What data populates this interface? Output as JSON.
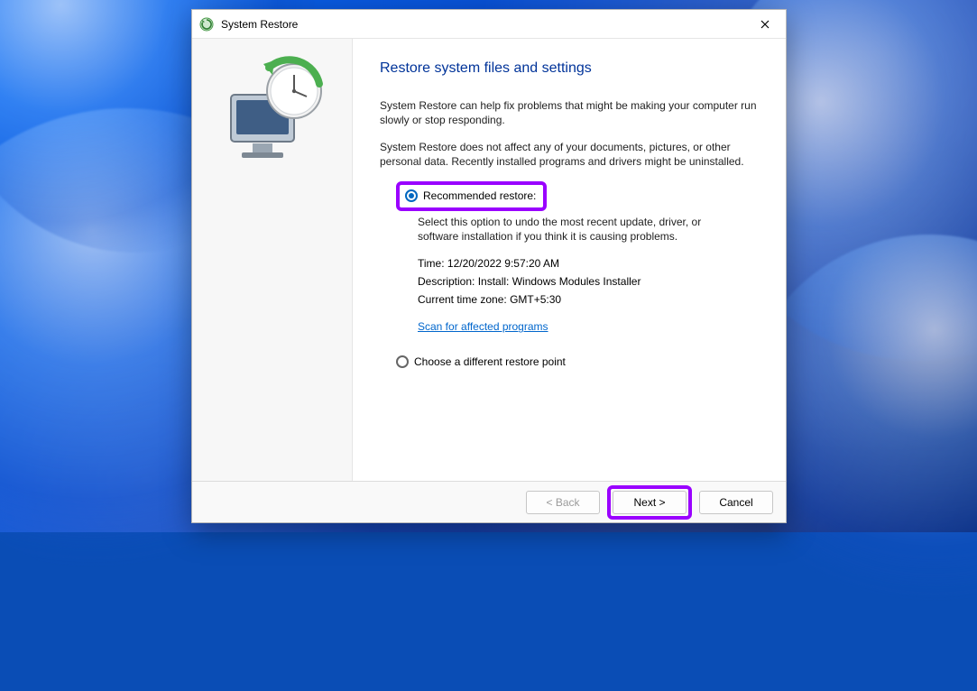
{
  "titlebar": {
    "title": "System Restore"
  },
  "heading": "Restore system files and settings",
  "intro1": "System Restore can help fix problems that might be making your computer run slowly or stop responding.",
  "intro2": "System Restore does not affect any of your documents, pictures, or other personal data. Recently installed programs and drivers might be uninstalled.",
  "options": {
    "recommended": {
      "label": "Recommended restore:",
      "description": "Select this option to undo the most recent update, driver, or software installation if you think it is causing problems.",
      "time_label": "Time:",
      "time_value": "12/20/2022 9:57:20 AM",
      "desc_label": "Description:",
      "desc_value": "Install: Windows Modules Installer",
      "tz_label": "Current time zone:",
      "tz_value": "GMT+5:30",
      "scan_link": "Scan for affected programs"
    },
    "choose_different": {
      "label": "Choose a different restore point"
    }
  },
  "buttons": {
    "back": "< Back",
    "next": "Next >",
    "cancel": "Cancel"
  }
}
